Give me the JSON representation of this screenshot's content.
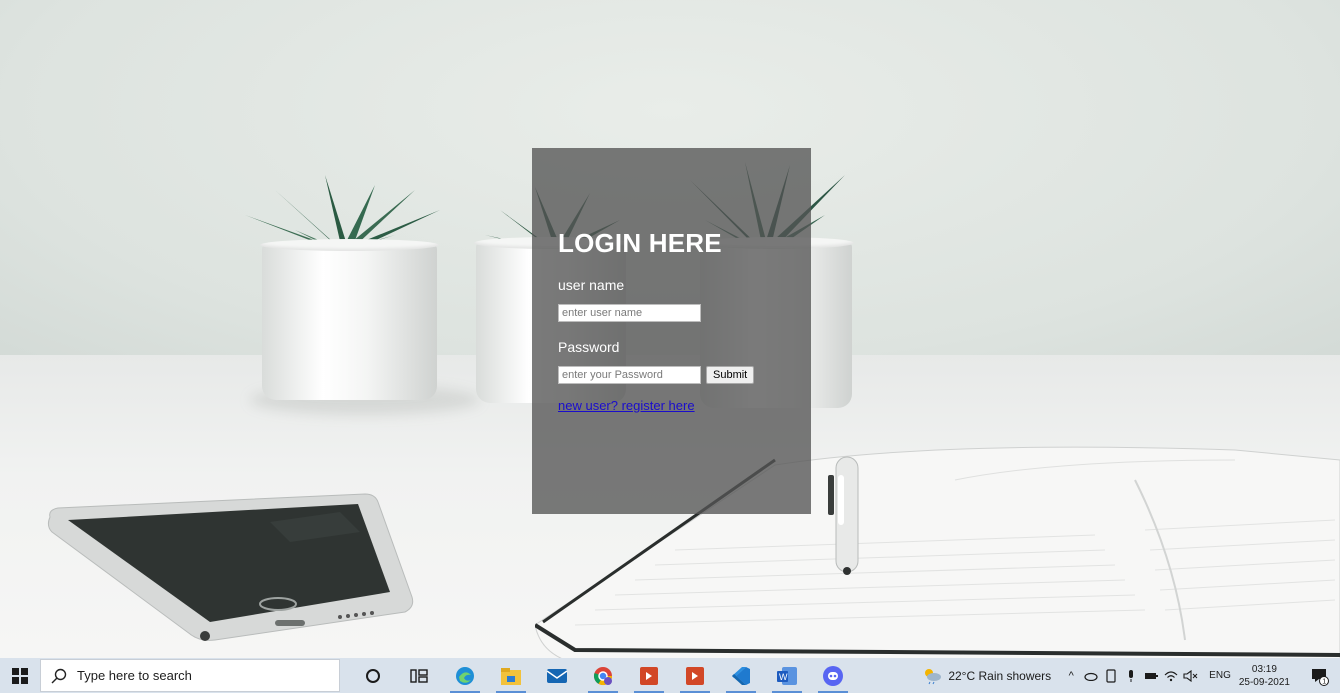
{
  "login": {
    "title": "LOGIN HERE",
    "username_label": "user name",
    "username_placeholder": "enter user name",
    "password_label": "Password",
    "password_placeholder": "enter your Password",
    "submit_label": "Submit",
    "register_link": "new user? register here"
  },
  "taskbar": {
    "search_placeholder": "Type here to search",
    "weather_text": "22°C  Rain showers",
    "language": "ENG",
    "time": "03:19",
    "date": "25-09-2021",
    "notification_count": "1",
    "apps": [
      "cortana-icon",
      "task-view-icon",
      "edge-icon",
      "file-explorer-icon",
      "mail-icon",
      "chrome-icon",
      "powerpoint-icon",
      "powerpoint-icon",
      "vscode-icon",
      "word-icon",
      "discord-icon"
    ]
  },
  "colors": {
    "panel_bg": "#555555",
    "link": "#1a0dcc",
    "taskbar_bg": "#d9e2ec"
  }
}
